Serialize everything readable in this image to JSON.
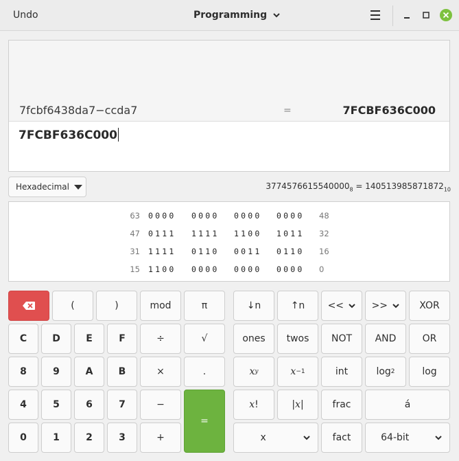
{
  "header": {
    "undo_label": "Undo",
    "mode_label": "Programming"
  },
  "display": {
    "history_expression": "7fcbf6438da7−ccda7",
    "history_equals": "=",
    "history_result": "7FCBF636C000",
    "entry_value": "7FCBF636C000"
  },
  "base_selector": {
    "value": "Hexadecimal"
  },
  "conversion": {
    "octal_value": "3774576615540000",
    "octal_sub": "8",
    "equals": "=",
    "decimal_value": "140513985871872",
    "decimal_sub": "10"
  },
  "bits": [
    {
      "hi": "63",
      "nibbles": [
        "0000",
        "0000",
        "0000",
        "0000"
      ],
      "lo": "48"
    },
    {
      "hi": "47",
      "nibbles": [
        "0111",
        "1111",
        "1100",
        "1011"
      ],
      "lo": "32"
    },
    {
      "hi": "31",
      "nibbles": [
        "1111",
        "0110",
        "0011",
        "0110"
      ],
      "lo": "16"
    },
    {
      "hi": "15",
      "nibbles": [
        "1100",
        "0000",
        "0000",
        "0000"
      ],
      "lo": "0"
    }
  ],
  "keys": {
    "open_paren": "(",
    "close_paren": ")",
    "mod": "mod",
    "pi": "π",
    "D": "D",
    "C": "C",
    "E": "E",
    "F": "F",
    "divide": "÷",
    "sqrt": "√",
    "n8": "8",
    "n9": "9",
    "A": "A",
    "B": "B",
    "multiply": "×",
    "point": ".",
    "n4": "4",
    "n5": "5",
    "n6": "6",
    "n7": "7",
    "minus": "−",
    "equals": "=",
    "n0": "0",
    "n1": "1",
    "n2": "2",
    "n3": "3",
    "plus": "+",
    "shift_down": "↓n",
    "shift_up": "↑n",
    "lshift": "<<",
    "rshift": ">>",
    "xor": "XOR",
    "ones": "ones",
    "twos": "twos",
    "not": "NOT",
    "and": "AND",
    "or": "OR",
    "x_pow_y_base": "x",
    "x_pow_y_exp": "y",
    "x_inv_base": "x",
    "x_inv_exp": "−1",
    "int": "int",
    "log2_base": "log",
    "log2_sub": "2",
    "log": "log",
    "factorial_base": "x",
    "factorial_sym": "!",
    "abs_base": "x",
    "abs_bar": "|",
    "frac": "frac",
    "char": "á",
    "var_x": "x",
    "fact": "fact",
    "word_size": "64-bit"
  },
  "colors": {
    "backspace": "#e04f4f",
    "equals": "#6db33f",
    "close": "#7dc13f"
  }
}
